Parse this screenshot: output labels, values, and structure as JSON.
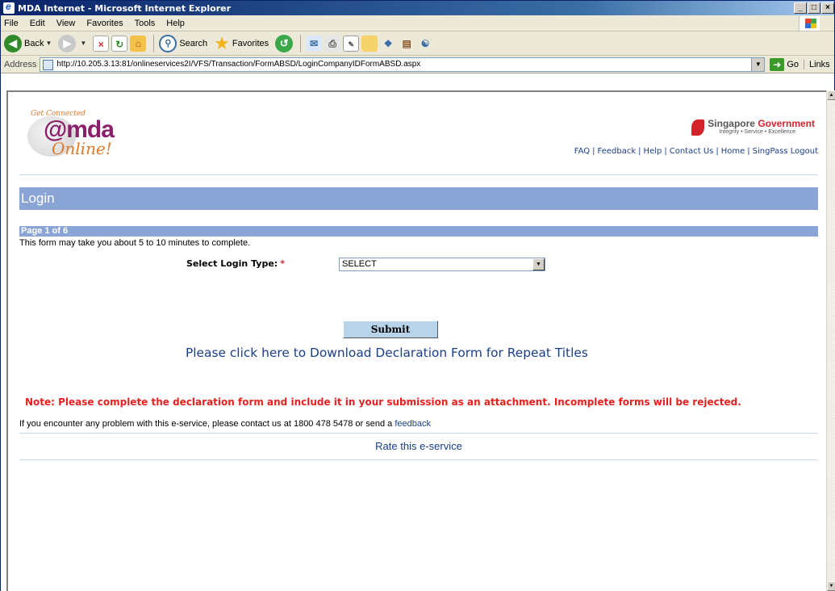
{
  "window": {
    "title": "MDA Internet - Microsoft Internet Explorer",
    "buttons": [
      "_",
      "□",
      "×"
    ]
  },
  "menu": [
    "File",
    "Edit",
    "View",
    "Favorites",
    "Tools",
    "Help"
  ],
  "toolbar": {
    "back_label": "Back",
    "search_label": "Search",
    "favorites_label": "Favorites"
  },
  "address": {
    "label": "Address",
    "url": "http://10.205.3.13:81/onlineservices2I/VFS/Transaction/FormABSD/LoginCompanyIDFormABSD.aspx",
    "go_label": "Go",
    "links_label": "Links"
  },
  "branding": {
    "logo_tag": "Get Connected",
    "logo_name": "@mda",
    "logo_online": "Online!",
    "gov_name_1": "Singapore",
    "gov_name_2": "Government",
    "gov_tagline": "Integrity • Service • Excellence"
  },
  "toplinks": [
    "FAQ",
    "Feedback",
    "Help",
    "Contact Us",
    "Home",
    "SingPass Logout"
  ],
  "page": {
    "heading": "Login",
    "page_indicator": "Page 1 of 6",
    "description": "This form may take you about 5 to 10 minutes to complete.",
    "login_type_label": "Select Login Type:",
    "required_mark": "*",
    "login_type_value": "SELECT",
    "submit_label": "Submit",
    "download_link": "Please click here to Download Declaration Form for Repeat Titles",
    "note": "Note: Please complete the declaration form and include it in your submission as an attachment. Incomplete forms will be rejected.",
    "contact_text": "If you encounter any problem with this e-service, please contact us at 1800 478 5478 or send a",
    "contact_link": "feedback",
    "rate_link": "Rate this e-service"
  },
  "colors": {
    "bar_blue": "#8aa5d5",
    "link_blue": "#1a3e8c",
    "note_red": "#e8201e"
  }
}
